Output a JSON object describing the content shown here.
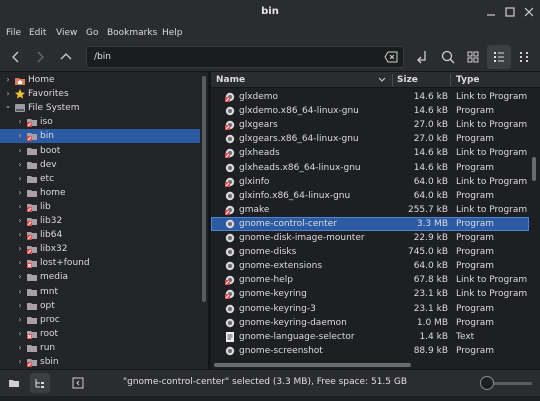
{
  "window": {
    "title": "bin"
  },
  "menu": [
    "File",
    "Edit",
    "View",
    "Go",
    "Bookmarks",
    "Help"
  ],
  "toolbar": {
    "location": "/bin"
  },
  "sidebar": {
    "items": [
      {
        "label": "Home",
        "level": 0,
        "expanded": false,
        "selected": false,
        "icon": "home-folder-icon"
      },
      {
        "label": "Favorites",
        "level": 0,
        "expanded": false,
        "selected": false,
        "icon": "star-icon"
      },
      {
        "label": "File System",
        "level": 0,
        "expanded": true,
        "selected": false,
        "icon": "drive-icon"
      },
      {
        "label": "iso",
        "level": 1,
        "selected": false,
        "icon": "link-folder-icon"
      },
      {
        "label": "bin",
        "level": 1,
        "selected": true,
        "icon": "link-folder-icon"
      },
      {
        "label": "boot",
        "level": 1,
        "selected": false,
        "icon": "folder-icon"
      },
      {
        "label": "dev",
        "level": 1,
        "selected": false,
        "icon": "folder-icon"
      },
      {
        "label": "etc",
        "level": 1,
        "selected": false,
        "icon": "folder-icon"
      },
      {
        "label": "home",
        "level": 1,
        "selected": false,
        "icon": "folder-icon"
      },
      {
        "label": "lib",
        "level": 1,
        "selected": false,
        "icon": "link-folder-icon"
      },
      {
        "label": "lib32",
        "level": 1,
        "selected": false,
        "icon": "link-folder-icon"
      },
      {
        "label": "lib64",
        "level": 1,
        "selected": false,
        "icon": "link-folder-icon"
      },
      {
        "label": "libx32",
        "level": 1,
        "selected": false,
        "icon": "link-folder-icon"
      },
      {
        "label": "lost+found",
        "level": 1,
        "selected": false,
        "icon": "locked-folder-icon"
      },
      {
        "label": "media",
        "level": 1,
        "selected": false,
        "icon": "folder-icon"
      },
      {
        "label": "mnt",
        "level": 1,
        "selected": false,
        "icon": "folder-icon"
      },
      {
        "label": "opt",
        "level": 1,
        "selected": false,
        "icon": "folder-icon"
      },
      {
        "label": "proc",
        "level": 1,
        "selected": false,
        "icon": "folder-icon"
      },
      {
        "label": "root",
        "level": 1,
        "selected": false,
        "icon": "locked-folder-icon"
      },
      {
        "label": "run",
        "level": 1,
        "selected": false,
        "icon": "folder-icon"
      },
      {
        "label": "sbin",
        "level": 1,
        "selected": false,
        "icon": "link-folder-icon"
      }
    ]
  },
  "columns": {
    "name": "Name",
    "size": "Size",
    "type": "Type"
  },
  "files": [
    {
      "name": "glxdemo",
      "size": "14.6 kB",
      "type": "Link to Program",
      "icon": "link-program-icon",
      "selected": false
    },
    {
      "name": "glxdemo.x86_64-linux-gnu",
      "size": "14.6 kB",
      "type": "Program",
      "icon": "program-icon",
      "selected": false
    },
    {
      "name": "glxgears",
      "size": "27.0 kB",
      "type": "Link to Program",
      "icon": "link-program-icon",
      "selected": false
    },
    {
      "name": "glxgears.x86_64-linux-gnu",
      "size": "27.0 kB",
      "type": "Program",
      "icon": "program-icon",
      "selected": false
    },
    {
      "name": "glxheads",
      "size": "14.6 kB",
      "type": "Link to Program",
      "icon": "link-program-icon",
      "selected": false
    },
    {
      "name": "glxheads.x86_64-linux-gnu",
      "size": "14.6 kB",
      "type": "Program",
      "icon": "program-icon",
      "selected": false
    },
    {
      "name": "glxinfo",
      "size": "64.0 kB",
      "type": "Link to Program",
      "icon": "link-program-icon",
      "selected": false
    },
    {
      "name": "glxinfo.x86_64-linux-gnu",
      "size": "64.0 kB",
      "type": "Program",
      "icon": "program-icon",
      "selected": false
    },
    {
      "name": "gmake",
      "size": "255.7 kB",
      "type": "Link to Program",
      "icon": "link-program-icon",
      "selected": false
    },
    {
      "name": "gnome-control-center",
      "size": "3.3 MB",
      "type": "Program",
      "icon": "program-icon",
      "selected": true
    },
    {
      "name": "gnome-disk-image-mounter",
      "size": "22.9 kB",
      "type": "Program",
      "icon": "program-icon",
      "selected": false
    },
    {
      "name": "gnome-disks",
      "size": "745.0 kB",
      "type": "Program",
      "icon": "program-icon",
      "selected": false
    },
    {
      "name": "gnome-extensions",
      "size": "64.0 kB",
      "type": "Program",
      "icon": "program-icon",
      "selected": false
    },
    {
      "name": "gnome-help",
      "size": "67.8 kB",
      "type": "Link to Program",
      "icon": "link-program-icon",
      "selected": false
    },
    {
      "name": "gnome-keyring",
      "size": "23.1 kB",
      "type": "Link to Program",
      "icon": "link-program-icon",
      "selected": false
    },
    {
      "name": "gnome-keyring-3",
      "size": "23.1 kB",
      "type": "Program",
      "icon": "program-icon",
      "selected": false
    },
    {
      "name": "gnome-keyring-daemon",
      "size": "1.0 MB",
      "type": "Program",
      "icon": "program-icon",
      "selected": false
    },
    {
      "name": "gnome-language-selector",
      "size": "1.4 kB",
      "type": "Text",
      "icon": "text-file-icon",
      "selected": false
    },
    {
      "name": "gnome-screenshot",
      "size": "88.9 kB",
      "type": "Program",
      "icon": "program-icon",
      "selected": false
    }
  ],
  "status": {
    "text": "\"gnome-control-center\" selected (3.3 MB), Free space: 51.5 GB"
  },
  "colors": {
    "selection": "#2c5ba3",
    "background": "#1e1f22",
    "chrome": "#2b2c2f"
  }
}
